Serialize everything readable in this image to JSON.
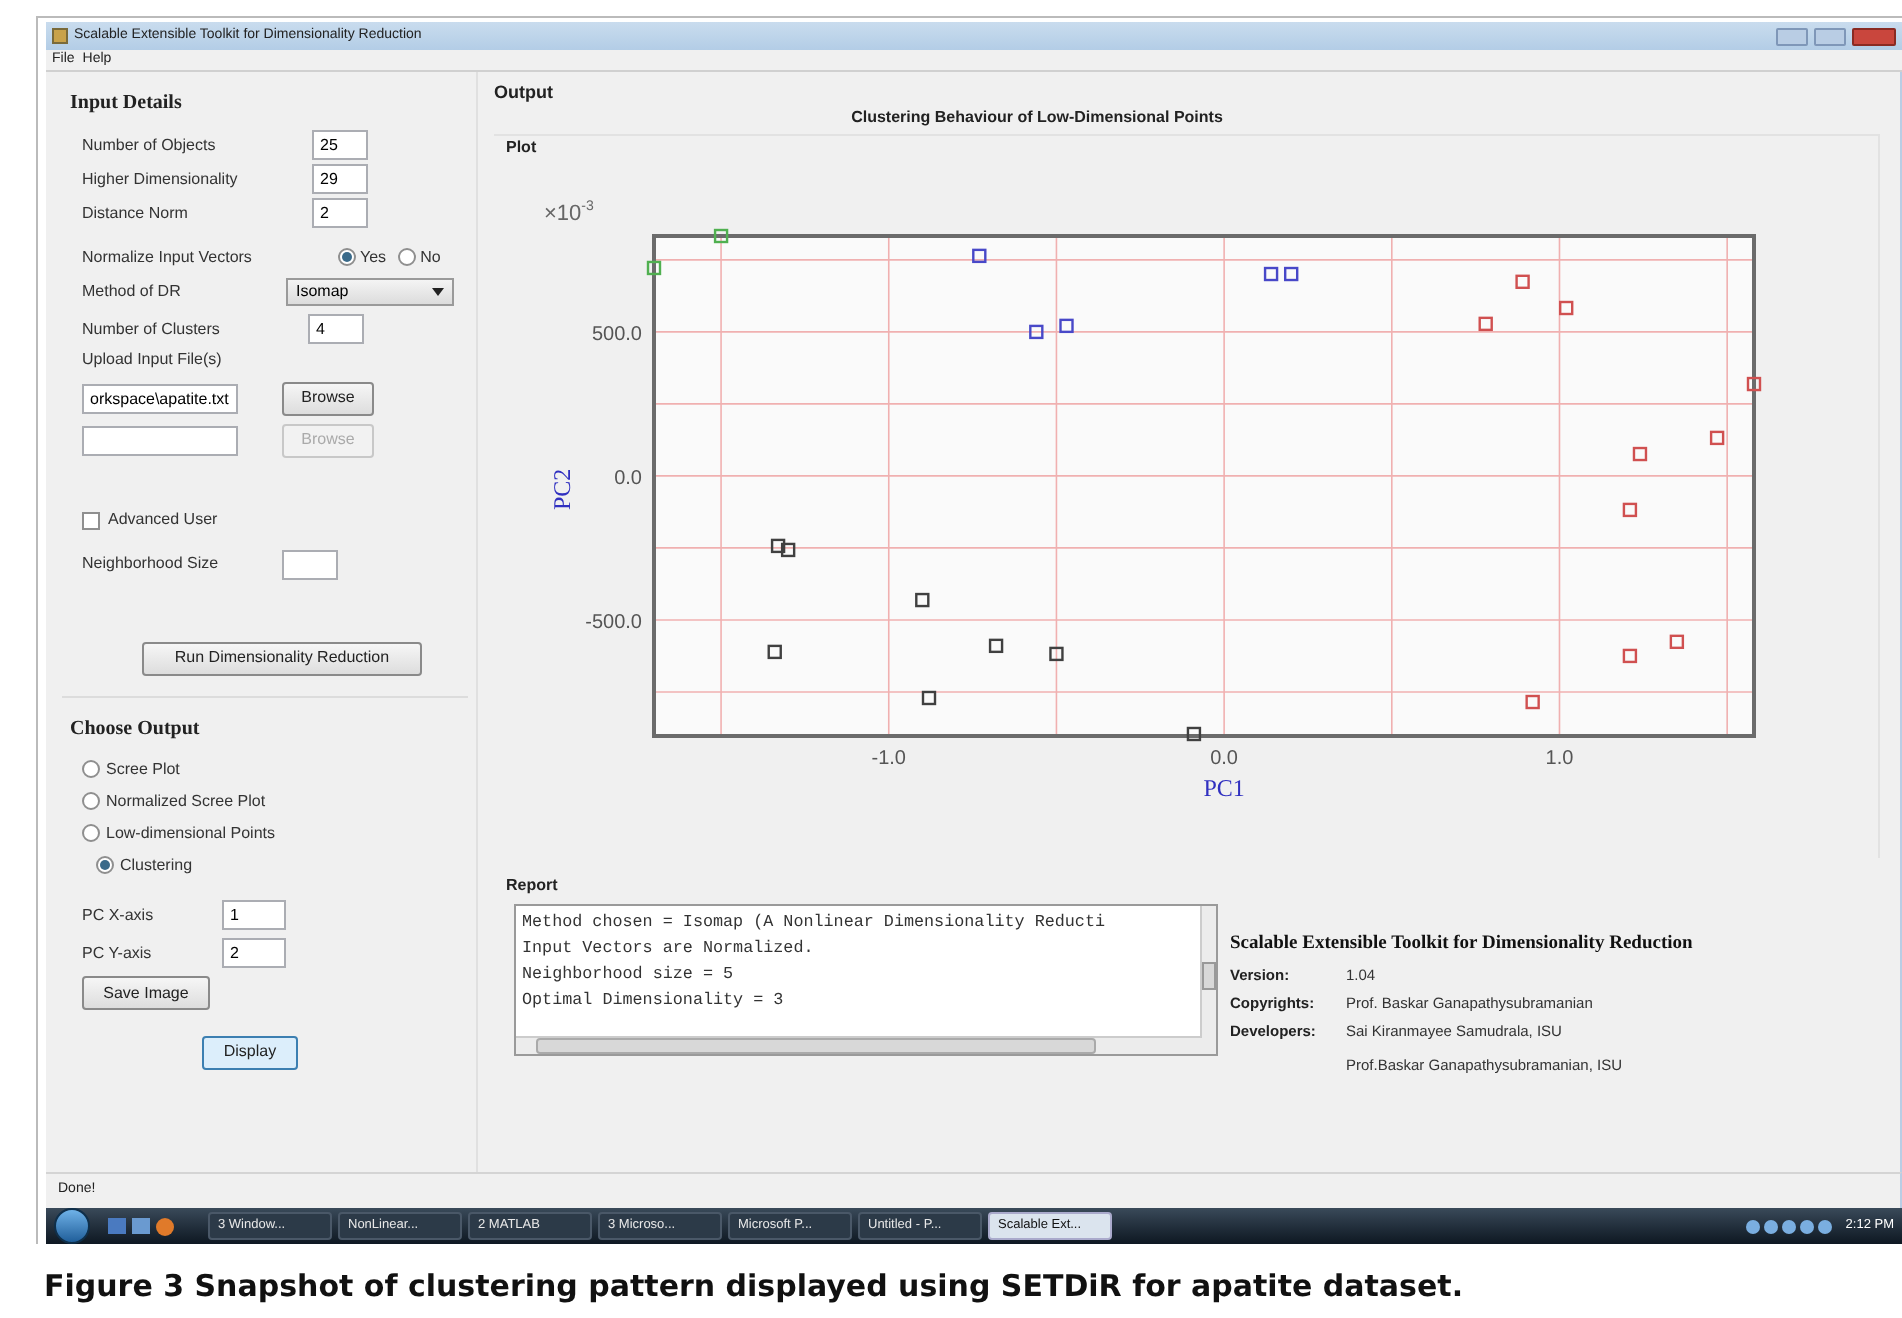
{
  "window": {
    "title": "Scalable Extensible Toolkit for Dimensionality Reduction"
  },
  "menu": [
    "File",
    "Help"
  ],
  "input_details": {
    "title": "Input Details",
    "number_fields": [
      {
        "label": "Number of Objects",
        "value": "25"
      },
      {
        "label": "Higher Dimensionality",
        "value": "29"
      },
      {
        "label": "Distance Norm",
        "value": "2"
      }
    ],
    "normalize": {
      "label": "Normalize Input Vectors",
      "options": [
        {
          "label": "Yes",
          "selected": true
        },
        {
          "label": "No",
          "selected": false
        }
      ]
    },
    "method": {
      "label": "Method of DR",
      "value": "Isomap"
    },
    "clusters": {
      "label": "Number of Clusters",
      "value": "4"
    },
    "upload": {
      "label": "Upload Input File(s)",
      "files": [
        {
          "value": "orkspace\\apatite.txt",
          "button": "Browse",
          "disabled": false
        },
        {
          "button": "Browse",
          "disabled": true
        }
      ]
    },
    "advanced": {
      "label": "Advanced User",
      "checked": false
    },
    "neighborhood": {
      "label": "Neighborhood Size"
    },
    "run_button": "Run Dimensionality Reduction"
  },
  "choose_output": {
    "title": "Choose Output",
    "options": [
      {
        "label": "Scree Plot",
        "selected": false
      },
      {
        "label": "Normalized Scree Plot",
        "selected": false
      },
      {
        "label": "Low-dimensional Points",
        "selected": false
      },
      {
        "label": "Clustering",
        "selected": true
      }
    ],
    "pc_fields": [
      {
        "label": "PC X-axis",
        "value": "1"
      },
      {
        "label": "PC Y-axis",
        "value": "2"
      }
    ],
    "save_button": "Save Image",
    "display_button": "Display"
  },
  "output": {
    "title": "Output",
    "plot_title": "Plot",
    "multiplier_base": "×10",
    "multiplier_exponent": "-3",
    "chart_data": {
      "type": "scatter",
      "grid": true,
      "title": "Clustering Behaviour of Low-Dimensional Points",
      "xlabel": "PC1",
      "ylabel": "PC2",
      "xlim": [
        -1.7,
        1.58
      ],
      "ylim": [
        -903,
        833
      ],
      "xticks": [
        {
          "value": -1,
          "label": "-1.0"
        },
        {
          "value": 0,
          "label": "0.0"
        },
        {
          "value": 1,
          "label": "1.0"
        }
      ],
      "yticks": [
        {
          "value": -500,
          "label": "-500.0"
        },
        {
          "value": 0,
          "label": "0.0"
        },
        {
          "value": 500,
          "label": "500.0"
        }
      ],
      "series": [
        {
          "color": "#4848c8",
          "x": [
            -0.73,
            -0.56,
            -0.47,
            0.14,
            0.2
          ],
          "values": [
            764,
            500,
            521,
            701,
            701
          ]
        },
        {
          "color": "#d05050",
          "x": [
            0.78,
            0.89,
            1.02,
            1.24,
            1.21,
            1.47,
            1.58,
            1.21,
            1.35,
            0.92
          ],
          "values": [
            528,
            674,
            583,
            76,
            -118,
            132,
            319,
            -625,
            -576,
            -785
          ]
        },
        {
          "color": "#404040",
          "x": [
            -1.33,
            -1.3,
            -1.34,
            -0.9,
            -0.68,
            -0.5,
            -0.88,
            -0.09
          ],
          "values": [
            -243,
            -257,
            -611,
            -431,
            -590,
            -618,
            -771,
            -896
          ]
        },
        {
          "color": "#50b050",
          "x": [
            -1.5,
            -1.7
          ],
          "values": [
            833,
            722
          ]
        }
      ]
    }
  },
  "report": {
    "title": "Report",
    "lines": [
      "Method chosen = Isomap (A Nonlinear Dimensionality Reducti",
      "Input Vectors are Normalized.",
      "Neighborhood size = 5",
      "Optimal Dimensionality = 3"
    ],
    "about": {
      "title": "Scalable Extensible Toolkit for Dimensionality Reduction",
      "entries": [
        {
          "label": "Version:",
          "values": [
            "1.04"
          ]
        },
        {
          "label": "Copyrights:",
          "values": [
            "Prof. Baskar Ganapathysubramanian"
          ]
        },
        {
          "label": "Developers:",
          "values": [
            "Sai Kiranmayee Samudrala, ISU",
            "Prof.Baskar Ganapathysubramanian, ISU"
          ]
        }
      ]
    }
  },
  "status_bar": "Done!",
  "taskbar": {
    "items": [
      {
        "label": "3 Window...",
        "selected": false
      },
      {
        "label": "NonLinear...",
        "selected": false
      },
      {
        "label": "2 MATLAB",
        "selected": false
      },
      {
        "label": "3 Microso...",
        "selected": false
      },
      {
        "label": "Microsoft P...",
        "selected": false
      },
      {
        "label": "Untitled - P...",
        "selected": false
      },
      {
        "label": "Scalable Ext...",
        "selected": true
      }
    ],
    "clock": "2:12 PM"
  },
  "caption": "Figure 3 Snapshot of clustering pattern displayed using SETDiR for apatite dataset."
}
